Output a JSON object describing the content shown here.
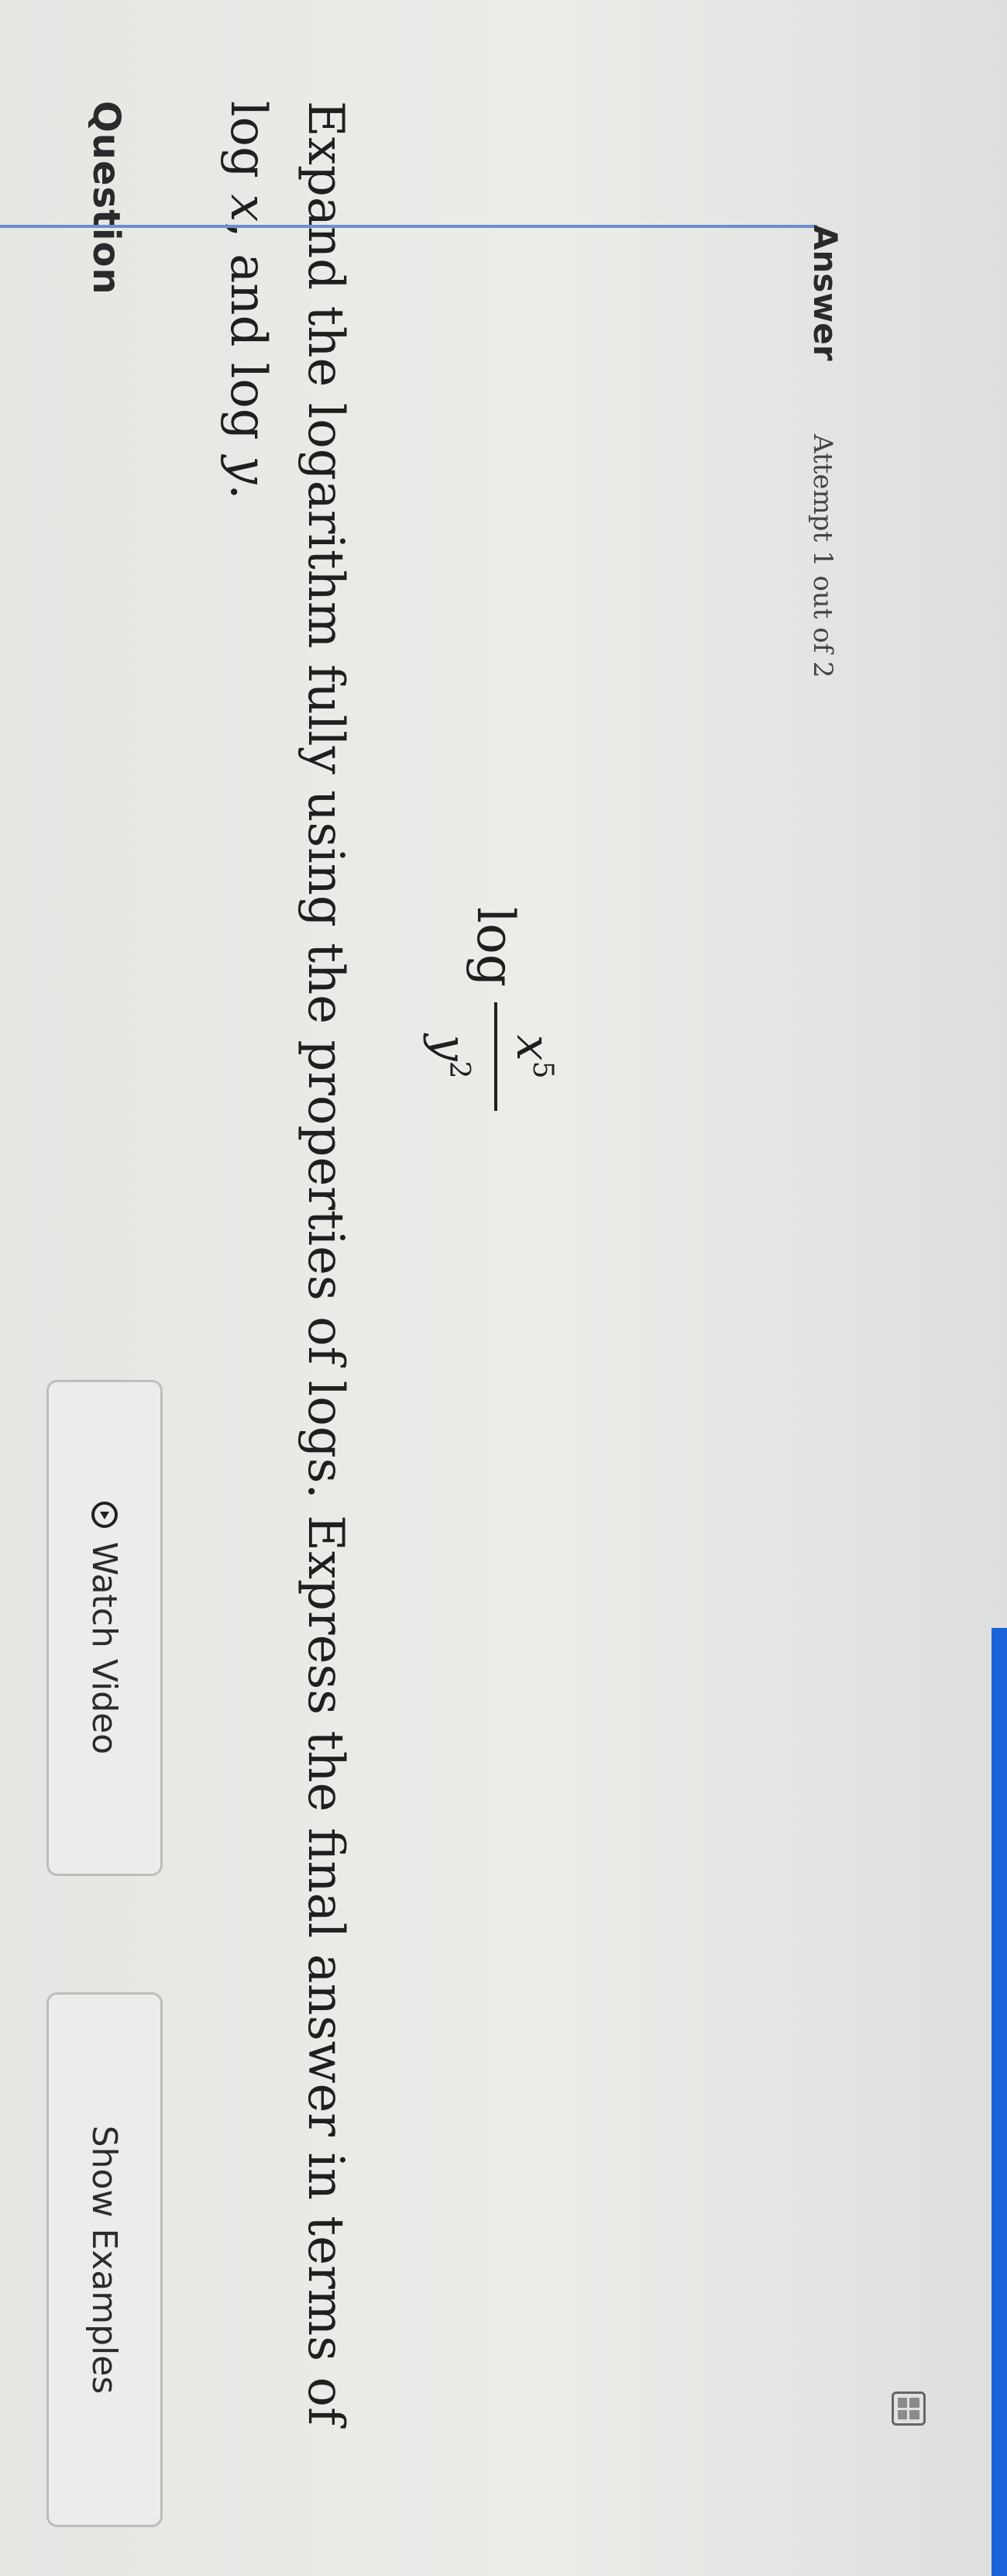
{
  "header": {
    "title": "Question"
  },
  "buttons": {
    "watch_video": "Watch Video",
    "show_examples": "Show Examples"
  },
  "question": {
    "part1": "Expand the logarithm fully using the properties of logs. Express the final answer in terms of log ",
    "var_x": "x",
    "part2": ", and log ",
    "var_y": "y",
    "part3": "."
  },
  "expression": {
    "log": "log",
    "numerator_base": "x",
    "numerator_exp": "5",
    "denominator_base": "y",
    "denominator_exp": "2"
  },
  "answer": {
    "label": "Answer",
    "attempt": "Attempt 1 out of 2"
  },
  "colors": {
    "accent": "#1b63d8"
  },
  "icons": {
    "video": "play-circle-icon",
    "calculator": "calculator-icon"
  }
}
